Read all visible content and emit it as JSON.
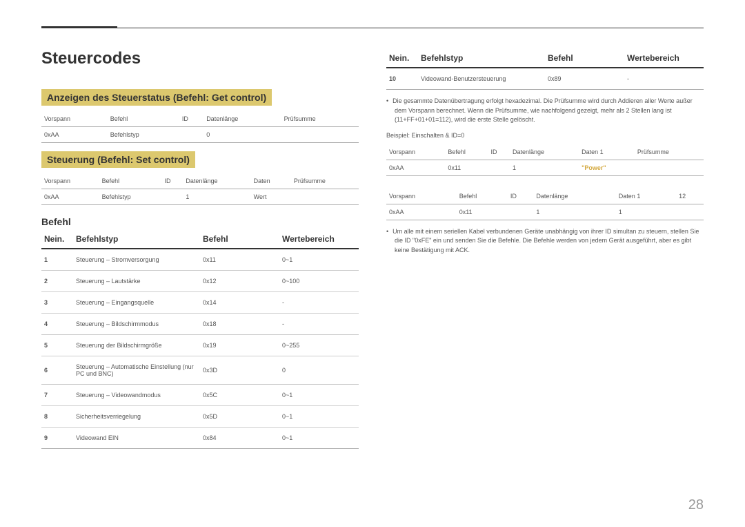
{
  "title": "Steuercodes",
  "section1": {
    "heading": "Anzeigen des Steuerstatus (Befehl: Get control)",
    "headers": [
      "Vorspann",
      "Befehl",
      "ID",
      "Datenlänge",
      "Prüfsumme"
    ],
    "row": [
      "0xAA",
      "Befehlstyp",
      "",
      "0",
      ""
    ]
  },
  "section2": {
    "heading": "Steuerung (Befehl: Set control)",
    "headers": [
      "Vorspann",
      "Befehl",
      "ID",
      "Datenlänge",
      "Daten",
      "Prüfsumme"
    ],
    "row": [
      "0xAA",
      "Befehlstyp",
      "",
      "1",
      "Wert",
      ""
    ]
  },
  "section3": {
    "heading": "Befehl",
    "headers": [
      "Nein.",
      "Befehlstyp",
      "Befehl",
      "Wertebereich"
    ],
    "rows": [
      [
        "1",
        "Steuerung – Stromversorgung",
        "0x11",
        "0~1"
      ],
      [
        "2",
        "Steuerung – Lautstärke",
        "0x12",
        "0~100"
      ],
      [
        "3",
        "Steuerung – Eingangsquelle",
        "0x14",
        "-"
      ],
      [
        "4",
        "Steuerung – Bildschirmmodus",
        "0x18",
        "-"
      ],
      [
        "5",
        "Steuerung der Bildschirmgröße",
        "0x19",
        "0~255"
      ],
      [
        "6",
        "Steuerung – Automatische Einstellung (nur PC und BNC)",
        "0x3D",
        "0"
      ],
      [
        "7",
        "Steuerung – Videowandmodus",
        "0x5C",
        "0~1"
      ],
      [
        "8",
        "Sicherheitsverriegelung",
        "0x5D",
        "0~1"
      ],
      [
        "9",
        "Videowand EIN",
        "0x84",
        "0~1"
      ]
    ]
  },
  "rightTable": {
    "headers": [
      "Nein.",
      "Befehlstyp",
      "Befehl",
      "Wertebereich"
    ],
    "row": [
      "10",
      "Videowand-Benutzersteuerung",
      "0x89",
      "-"
    ]
  },
  "note1": "Die gesammte Datenübertragung erfolgt hexadezimal. Die Prüfsumme wird durch Addieren aller Werte außer dem Vorspann berechnet. Wenn die Prüfsumme, wie nachfolgend gezeigt, mehr als 2 Stellen lang ist (11+FF+01+01=112), wird die erste Stelle gelöscht.",
  "exampleLabel": "Beispiel: Einschalten & ID=0",
  "tableA": {
    "headers": [
      "Vorspann",
      "Befehl",
      "ID",
      "Datenlänge",
      "Daten 1",
      "Prüfsumme"
    ],
    "row": [
      "0xAA",
      "0x11",
      "",
      "1",
      "\"Power\"",
      ""
    ]
  },
  "tableB": {
    "headers": [
      "Vorspann",
      "Befehl",
      "ID",
      "Datenlänge",
      "Daten 1",
      "12"
    ],
    "row": [
      "0xAA",
      "0x11",
      "",
      "1",
      "1",
      ""
    ]
  },
  "note2": "Um alle mit einem seriellen Kabel verbundenen Geräte unabhängig von ihrer ID simultan zu steuern, stellen Sie die ID \"0xFE\" ein und senden Sie die Befehle. Die Befehle werden von jedem Gerät ausgeführt, aber es gibt keine Bestätigung mit ACK.",
  "pageNumber": "28"
}
